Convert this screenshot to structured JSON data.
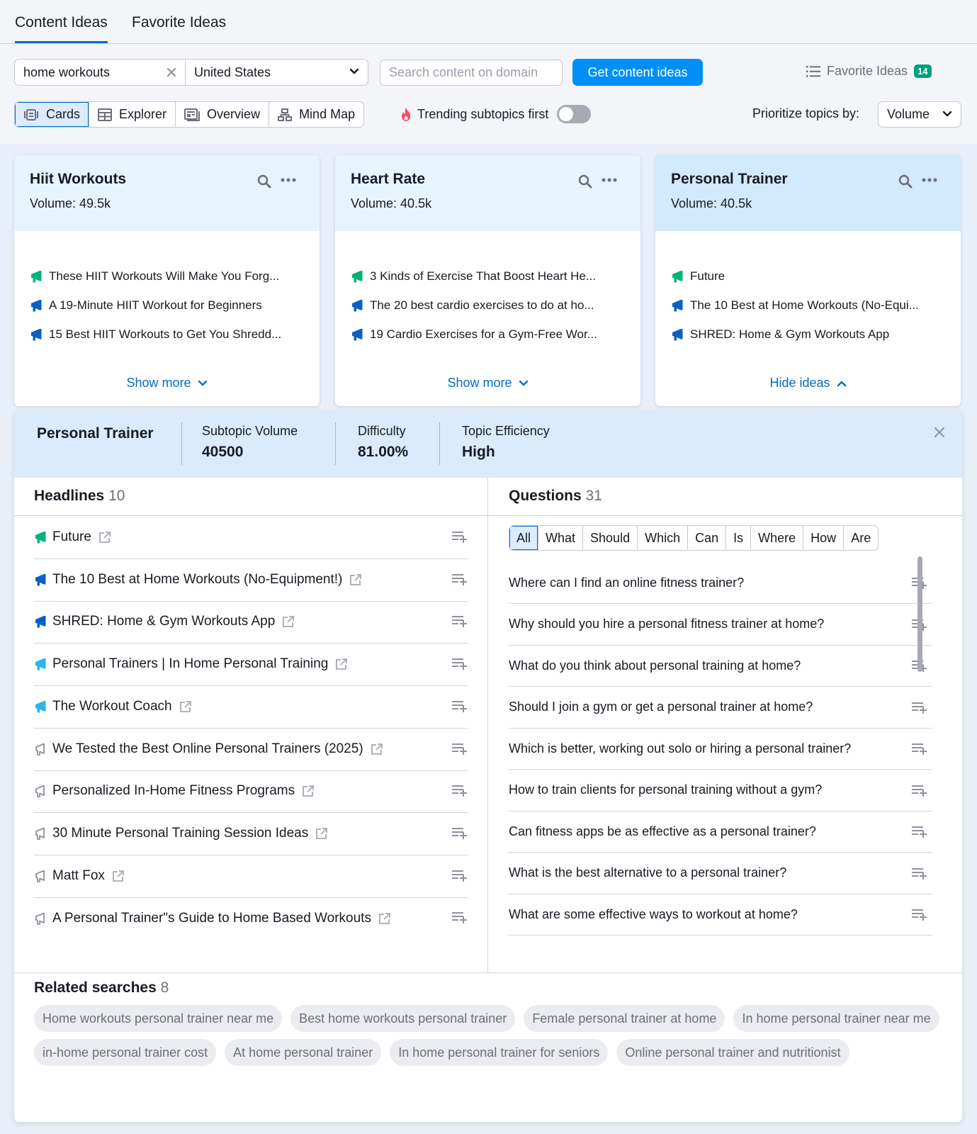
{
  "tabs": [
    {
      "label": "Content Ideas",
      "active": true
    },
    {
      "label": "Favorite Ideas",
      "active": false
    }
  ],
  "search": {
    "keyword": "home workouts",
    "country": "United States",
    "domain_placeholder": "Search content on domain",
    "submit_label": "Get content ideas"
  },
  "favorites": {
    "label": "Favorite Ideas",
    "count": "14"
  },
  "views": [
    {
      "label": "Cards",
      "icon": "cards-icon",
      "active": true
    },
    {
      "label": "Explorer",
      "icon": "table-icon",
      "active": false
    },
    {
      "label": "Overview",
      "icon": "overview-icon",
      "active": false
    },
    {
      "label": "Mind Map",
      "icon": "mind-map-icon",
      "active": false
    }
  ],
  "trending": {
    "label": "Trending subtopics first",
    "enabled": false
  },
  "prioritize": {
    "label": "Prioritize topics by:",
    "value": "Volume"
  },
  "colors": {
    "accent": "#008ff8",
    "link": "#006dca",
    "idea_green": "#00b37a",
    "idea_blue": "#0a5fc7",
    "idea_lightblue": "#2bb3f0",
    "idea_gray": "#8f929c",
    "badge": "#009f81"
  },
  "cards": [
    {
      "title": "Hiit Workouts",
      "volume": "Volume: 49.5k",
      "ideas": [
        {
          "text": "These HIIT Workouts Will Make You Forg...",
          "level": "green"
        },
        {
          "text": "A 19-Minute HIIT Workout for Beginners",
          "level": "blue"
        },
        {
          "text": "15 Best HIIT Workouts to Get You Shredd...",
          "level": "blue"
        }
      ],
      "footer": "Show more"
    },
    {
      "title": "Heart Rate",
      "volume": "Volume: 40.5k",
      "ideas": [
        {
          "text": "3 Kinds of Exercise That Boost Heart He...",
          "level": "green"
        },
        {
          "text": "The 20 best cardio exercises to do at ho...",
          "level": "blue"
        },
        {
          "text": "19 Cardio Exercises for a Gym-Free Wor...",
          "level": "blue"
        }
      ],
      "footer": "Show more"
    },
    {
      "title": "Personal Trainer",
      "volume": "Volume: 40.5k",
      "ideas": [
        {
          "text": "Future",
          "level": "green"
        },
        {
          "text": "The 10 Best at Home Workouts (No-Equi...",
          "level": "blue"
        },
        {
          "text": "SHRED: Home & Gym Workouts App",
          "level": "blue"
        }
      ],
      "footer": "Hide ideas"
    }
  ],
  "detail": {
    "title": "Personal Trainer",
    "metrics": [
      {
        "label": "Subtopic Volume",
        "value": "40500"
      },
      {
        "label": "Difficulty",
        "value": "81.00%"
      },
      {
        "label": "Topic Efficiency",
        "value": "High"
      }
    ],
    "headlines": {
      "title": "Headlines",
      "count": "10",
      "items": [
        {
          "text": "Future",
          "level": "green"
        },
        {
          "text": "The 10 Best at Home Workouts (No-Equipment!)",
          "level": "blue"
        },
        {
          "text": "SHRED: Home & Gym Workouts App",
          "level": "blue"
        },
        {
          "text": "Personal Trainers | In Home Personal Training",
          "level": "lightblue"
        },
        {
          "text": "The Workout Coach",
          "level": "lightblue"
        },
        {
          "text": "We Tested the Best Online Personal Trainers (2025)",
          "level": "gray"
        },
        {
          "text": "Personalized In-Home Fitness Programs",
          "level": "gray"
        },
        {
          "text": "30 Minute Personal Training Session Ideas",
          "level": "gray"
        },
        {
          "text": "Matt Fox",
          "level": "gray"
        },
        {
          "text": "A Personal Trainer\"s Guide to Home Based Workouts",
          "level": "gray"
        }
      ]
    },
    "questions": {
      "title": "Questions",
      "count": "31",
      "filters": [
        {
          "label": "All",
          "active": true
        },
        {
          "label": "What",
          "active": false
        },
        {
          "label": "Should",
          "active": false
        },
        {
          "label": "Which",
          "active": false
        },
        {
          "label": "Can",
          "active": false
        },
        {
          "label": "Is",
          "active": false
        },
        {
          "label": "Where",
          "active": false
        },
        {
          "label": "How",
          "active": false
        },
        {
          "label": "Are",
          "active": false
        }
      ],
      "items": [
        "Where can I find an online fitness trainer?",
        "Why should you hire a personal fitness trainer at home?",
        "What do you think about personal training at home?",
        "Should I join a gym or get a personal trainer at home?",
        "Which is better, working out solo or hiring a personal trainer?",
        "How to train clients for personal training without a gym?",
        "Can fitness apps be as effective as a personal trainer?",
        "What is the best alternative to a personal trainer?",
        "What are some effective ways to workout at home?"
      ]
    },
    "related": {
      "title": "Related searches",
      "count": "8",
      "items": [
        "Home workouts personal trainer near me",
        "Best home workouts personal trainer",
        "Female personal trainer at home",
        "In home personal trainer near me",
        "in-home personal trainer cost",
        "At home personal trainer",
        "In home personal trainer for seniors",
        "Online personal trainer and nutritionist"
      ]
    }
  }
}
